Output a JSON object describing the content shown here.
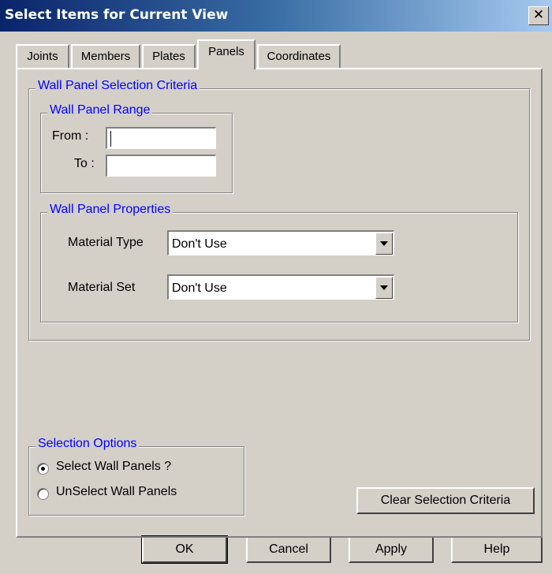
{
  "window": {
    "title": "Select Items for Current View",
    "close_glyph": "✕"
  },
  "tabs": [
    {
      "label": "Joints",
      "active": false
    },
    {
      "label": "Members",
      "active": false
    },
    {
      "label": "Plates",
      "active": false
    },
    {
      "label": "Panels",
      "active": true
    },
    {
      "label": "Coordinates",
      "active": false
    }
  ],
  "criteria": {
    "legend": "Wall Panel Selection Criteria",
    "range": {
      "legend": "Wall Panel Range",
      "from_label": "From :",
      "from_value": "",
      "to_label": "To :",
      "to_value": ""
    },
    "properties": {
      "legend": "Wall Panel Properties",
      "material_type_label": "Material Type",
      "material_type_value": "Don't Use",
      "material_set_label": "Material Set",
      "material_set_value": "Don't Use"
    }
  },
  "selection_options": {
    "legend": "Selection Options",
    "options": [
      {
        "label": "Select Wall Panels ?",
        "selected": true
      },
      {
        "label": "UnSelect Wall Panels",
        "selected": false
      }
    ]
  },
  "clear_button": "Clear Selection Criteria",
  "footer": {
    "ok": "OK",
    "cancel": "Cancel",
    "apply": "Apply",
    "help": "Help"
  },
  "icons": {
    "close": "close-icon",
    "dropdown": "chevron-down-icon"
  },
  "colors": {
    "title_gradient_start": "#0a246a",
    "title_gradient_end": "#a6caf0",
    "group_legend": "#0000ff",
    "face": "#d4d0c8"
  }
}
